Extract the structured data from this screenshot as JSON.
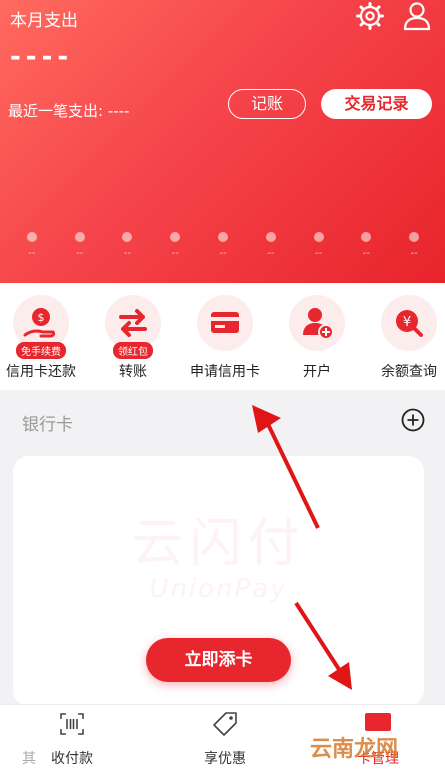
{
  "header": {
    "title": "本月支出",
    "amount": "----",
    "recent_expense": "最近一笔支出: ----",
    "record_button": "记账",
    "transactions_button": "交易记录"
  },
  "chart_dots": [
    "--",
    "--",
    "--",
    "--",
    "--",
    "--",
    "--",
    "--",
    "--"
  ],
  "quick_actions": [
    {
      "label": "信用卡还款",
      "badge": "免手续费",
      "icon": "repay-icon"
    },
    {
      "label": "转账",
      "badge": "领红包",
      "icon": "transfer-icon"
    },
    {
      "label": "申请信用卡",
      "badge": "",
      "icon": "card-apply-icon"
    },
    {
      "label": "开户",
      "badge": "",
      "icon": "open-account-icon"
    },
    {
      "label": "余额查询",
      "badge": "",
      "icon": "balance-icon"
    }
  ],
  "bank_section": {
    "title": "银行卡",
    "watermark_cn": "云闪付",
    "watermark_en": "UnionPay",
    "add_card_button": "立即添卡"
  },
  "tabbar": {
    "left_partial": "其",
    "pay_label": "收付款",
    "deals_label": "享优惠",
    "card_label": "卡管理",
    "watermark_text": "云南龙网"
  },
  "colors": {
    "accent": "#e8262e",
    "hero_light": "#ff6a5f",
    "hero_dark": "#e8242b",
    "arrow": "#e01616"
  }
}
